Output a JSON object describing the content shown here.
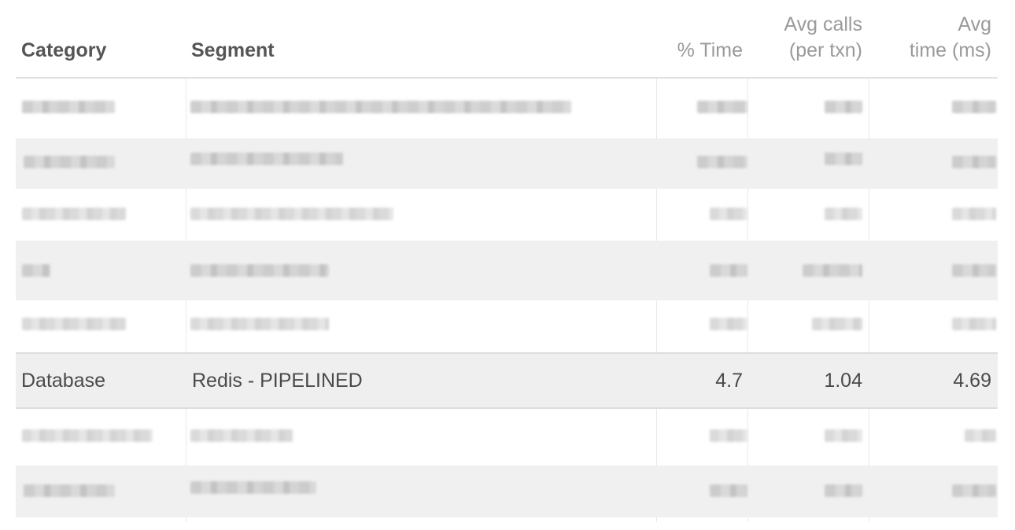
{
  "table": {
    "headers": {
      "category": "Category",
      "segment": "Segment",
      "time": "% Time",
      "avg_calls_line1": "Avg calls",
      "avg_calls_line2": "(per txn)",
      "avg_time_line1": "Avg",
      "avg_time_line2": "time (ms)"
    },
    "highlighted_row": {
      "category": "Database",
      "segment": "Redis - PIPELINED",
      "time": "4.7",
      "avg_calls": "1.04",
      "avg_time": "4.69"
    },
    "blurred_rows_above": 5,
    "blurred_rows_below": 2
  }
}
